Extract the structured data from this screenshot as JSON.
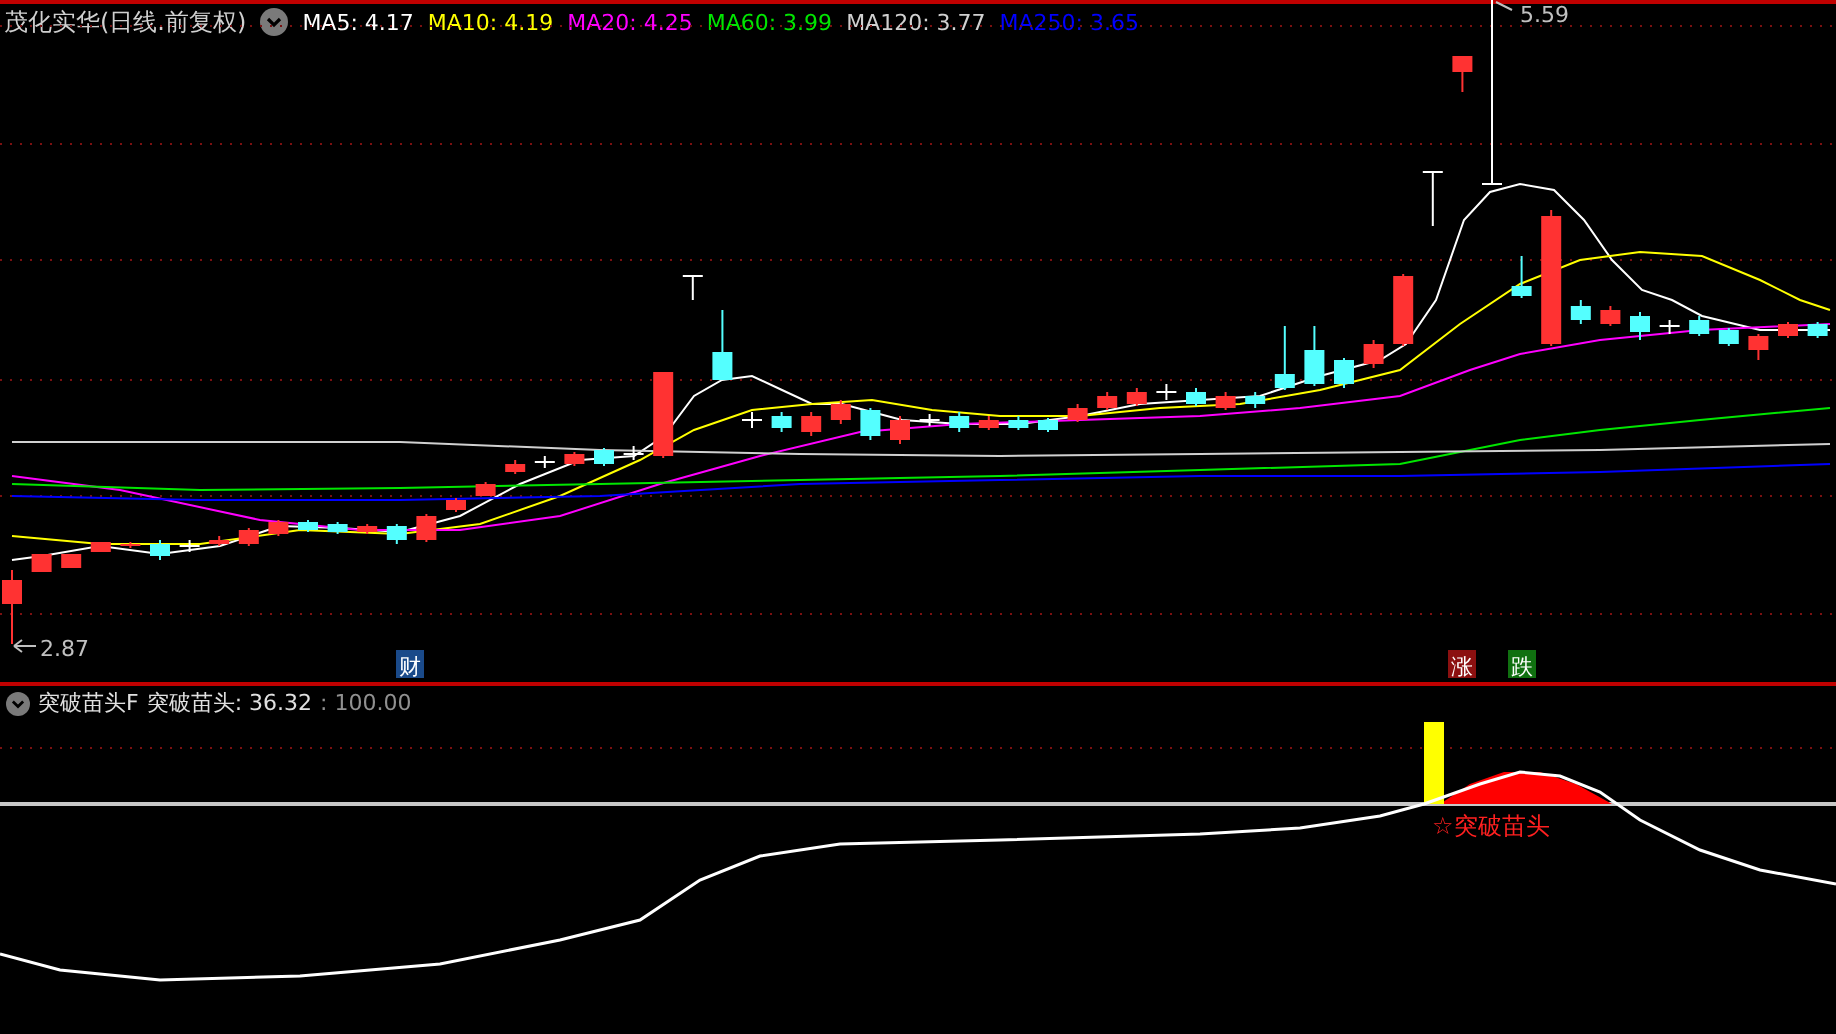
{
  "title": "茂化实华(日线.前复权)",
  "ma_legend": [
    {
      "label": "MA5: 4.17",
      "color": "#ffffff"
    },
    {
      "label": "MA10: 4.19",
      "color": "#ffff00"
    },
    {
      "label": "MA20: 4.25",
      "color": "#ff00ff"
    },
    {
      "label": "MA60: 3.99",
      "color": "#00e600"
    },
    {
      "label": "MA120: 3.77",
      "color": "#d0d0d0"
    },
    {
      "label": "MA250: 3.65",
      "color": "#0000ff"
    }
  ],
  "price_labels": {
    "high": "5.59",
    "low": "2.87"
  },
  "event_markers": [
    {
      "text": "财",
      "color": "#1a4a8a"
    },
    {
      "text": "涨",
      "color": "#8b1010"
    },
    {
      "text": "跌",
      "color": "#107010"
    }
  ],
  "indicator": {
    "name": "突破苗头F",
    "value_label": "突破苗头: 36.32",
    "scale": ": 100.00",
    "signal_label": "☆突破苗头"
  }
}
